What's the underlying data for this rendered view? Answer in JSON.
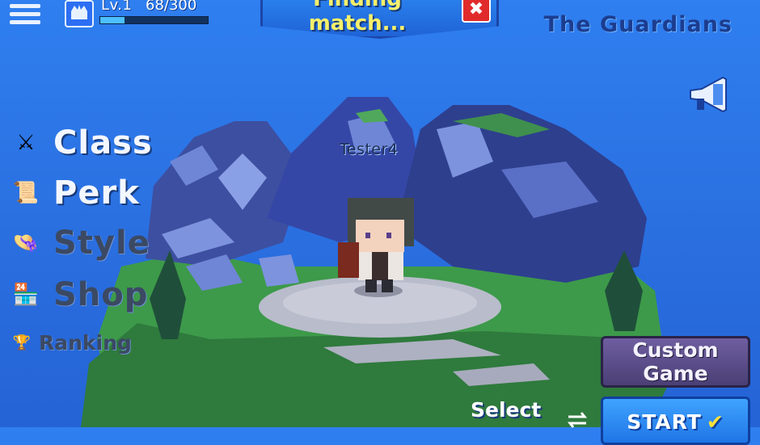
{
  "hud": {
    "level": "Lv.1",
    "xp": "68/300",
    "xp_fraction": 0.2267
  },
  "matchmaking": {
    "line1": "Finding",
    "line2": "match...",
    "cancel_icon": "✖"
  },
  "team": {
    "name": "The Guardians"
  },
  "menu": {
    "items": [
      {
        "label": "Class",
        "icon": "⚔",
        "enabled": true
      },
      {
        "label": "Perk",
        "icon": "📜",
        "enabled": true
      },
      {
        "label": "Style",
        "icon": "👒",
        "enabled": false
      },
      {
        "label": "Shop",
        "icon": "🏪",
        "enabled": false
      }
    ],
    "ranking": {
      "label": "Ranking",
      "icon": "🏆"
    }
  },
  "player": {
    "name": "Tester4"
  },
  "actions": {
    "custom_line1": "Custom",
    "custom_line2": "Game",
    "select_label": "Select",
    "start_label": "START",
    "start_icon": "✔"
  },
  "colors": {
    "sky": "#2a6fe0",
    "title": "#f6f06a",
    "team": "#1c3d8f",
    "cancel": "#e12b2b"
  }
}
